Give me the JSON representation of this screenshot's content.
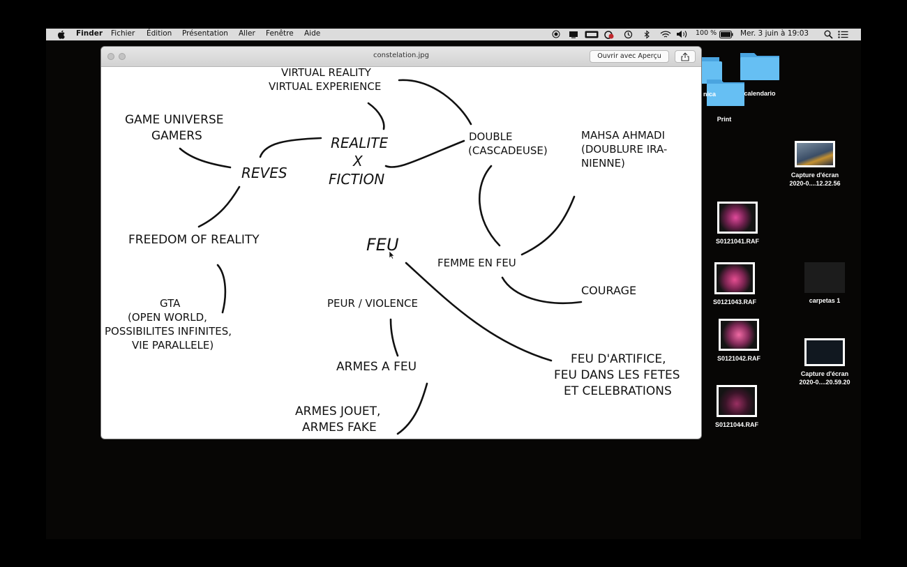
{
  "menubar": {
    "app_name": "Finder",
    "menus": [
      "Fichier",
      "Édition",
      "Présentation",
      "Aller",
      "Fenêtre",
      "Aide"
    ],
    "battery_percent": "100 %",
    "datetime": "Mer. 3 juin à 19:03"
  },
  "preview_window": {
    "title": "constelation.jpg",
    "open_with_button": "Ouvrir avec Aperçu"
  },
  "mind_map": {
    "words": [
      "VIRTUAL REALITY",
      "VIRTUAL EXPERIENCE",
      "GAME UNIVERSE",
      "GAMERS",
      "REALITE",
      "X",
      "FICTION",
      "REVES",
      "DOUBLE",
      "(CASCADEUSE)",
      "MAHSA AHMADI",
      "(DOUBLURE IRA-",
      "NIENNE)",
      "FREEDOM OF REALITY",
      "FEU",
      "FEMME EN FEU",
      "COURAGE",
      "GTA",
      "(OPEN WORLD,",
      "POSSIBILITES INFINITES,",
      "VIE PARALLELE)",
      "PEUR / VIOLENCE",
      "ARMES A FEU",
      "FEU D'ARTIFICE,",
      "FEU DANS LES FETES",
      "ET CELEBRATIONS",
      "ARMES JOUET,",
      "ARMES FAKE"
    ]
  },
  "desktop": {
    "folders": [
      "calendario",
      "nica",
      "Print"
    ],
    "files": [
      {
        "name": "Capture d'écran\n2020-0....12.22.56"
      },
      {
        "name": "S0121041.RAF"
      },
      {
        "name": "S0121043.RAF"
      },
      {
        "name": "carpetas 1"
      },
      {
        "name": "S0121042.RAF"
      },
      {
        "name": "Capture d'écran\n2020-0....20.59.20"
      },
      {
        "name": "S0121044.RAF"
      }
    ]
  },
  "colors": {
    "menubar_bg": "#dcdcdc",
    "folder_blue": "#5fb8ee",
    "desktop_bg": "#070605"
  }
}
